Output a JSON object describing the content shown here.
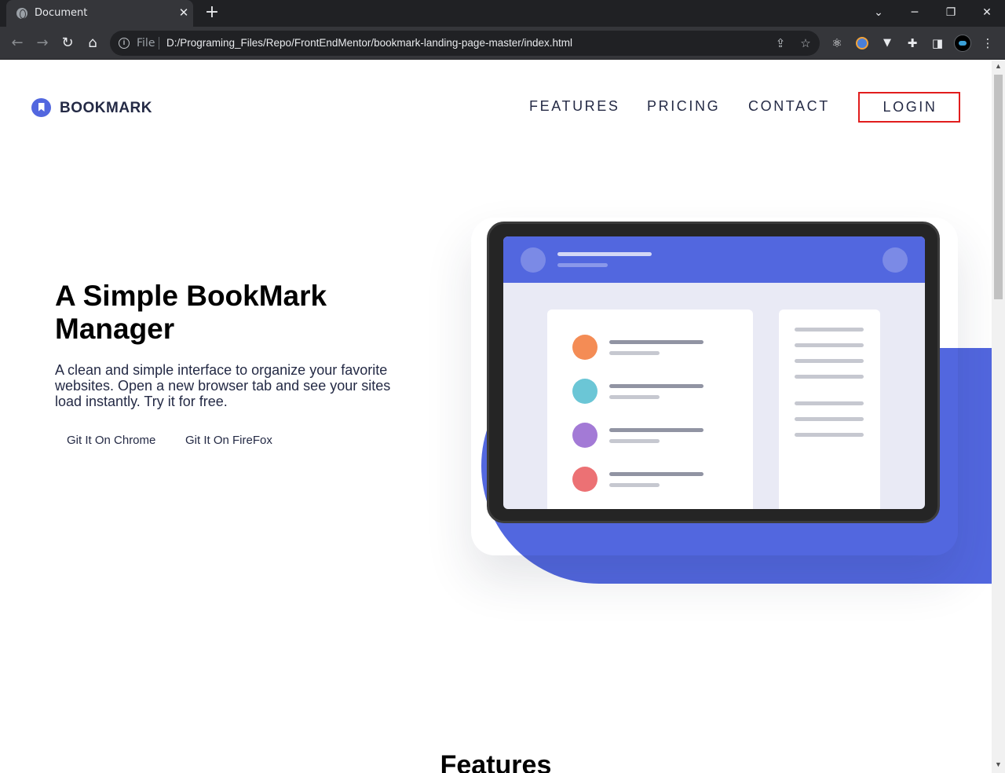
{
  "browser": {
    "tab_title": "Document",
    "tab_close": "✕",
    "new_tab": "+",
    "file_label": "File",
    "url": "D:/Programing_Files/Repo/FrontEndMentor/bookmark-landing-page-master/index.html"
  },
  "header": {
    "logo_text": "BOOKMARK",
    "nav": [
      "FEATURES",
      "PRICING",
      "CONTACT"
    ],
    "login": "LOGIN"
  },
  "hero": {
    "title": "A Simple BookMark Manager",
    "text": "A clean and simple interface to organize your favorite websites. Open a new browser tab and see your sites load instantly. Try it for free.",
    "buttons": [
      "Git It On Chrome",
      "Git It On FireFox"
    ]
  },
  "features": {
    "title": "Features"
  },
  "colors": {
    "accent": "#5267df",
    "login_border": "#e11d1d",
    "dots": [
      "#f48c55",
      "#6bc6d6",
      "#a37ad6",
      "#ec7174"
    ]
  }
}
